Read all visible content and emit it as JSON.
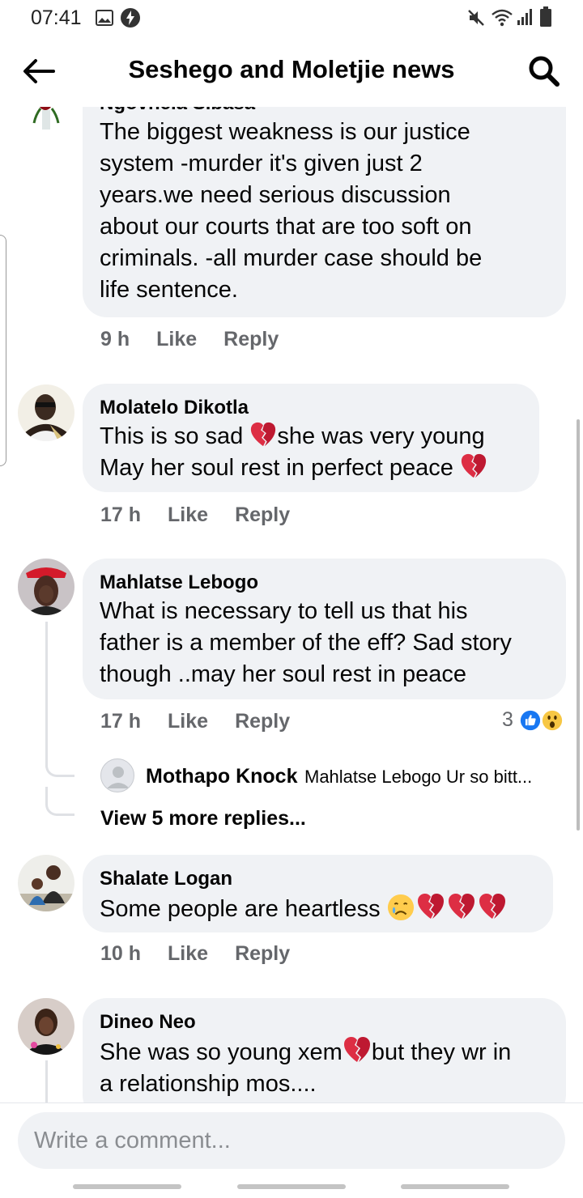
{
  "status_bar": {
    "time": "07:41",
    "icons": [
      "gallery-icon",
      "bolt-icon",
      "mute-icon",
      "wifi-icon",
      "signal-icon",
      "battery-icon"
    ]
  },
  "header": {
    "title": "Seshego and Moletjie news",
    "back_icon": "back-arrow-icon",
    "search_icon": "search-icon"
  },
  "comments": [
    {
      "author": "Ngovhela Sibasa",
      "text": "The biggest  weakness  is our justice\nsystem -murder it's given just 2\nyears.we need serious  discussion\nabout our courts that are too soft on\ncriminals. -all murder case should be\nlife sentence.",
      "time": "9 h",
      "like": "Like",
      "reply": "Reply"
    },
    {
      "author": "Molatelo Dikotla",
      "text_parts": [
        "This is so sad ",
        "she was very young",
        "May her soul rest in perfect peace "
      ],
      "time": "17 h",
      "like": "Like",
      "reply": "Reply"
    },
    {
      "author": "Mahlatse Lebogo",
      "text": "What is necessary to tell us that his\nfather is a member of the eff? Sad story\nthough ..may her soul rest in peace",
      "time": "17 h",
      "like": "Like",
      "reply": "Reply",
      "reaction_count": "3",
      "reaction_icons": [
        "like-reaction-icon",
        "wow-reaction-icon"
      ],
      "reply_preview": {
        "author": "Mothapo Knock",
        "text": "Mahlatse Lebogo Ur so bitt..."
      },
      "view_more": "View 5 more replies..."
    },
    {
      "author": "Shalate Logan",
      "text": "Some people are heartless ",
      "time": "10 h",
      "like": "Like",
      "reply": "Reply"
    },
    {
      "author": "Dineo Neo",
      "text_parts": [
        "She was so young xem",
        "but they wr in",
        "a relationship mos...."
      ]
    }
  ],
  "composer": {
    "placeholder": "Write a comment..."
  },
  "colors": {
    "bubble": "#f0f2f5",
    "meta_text": "#65676b",
    "like_blue": "#1877f2",
    "broken_heart": "#e8334a"
  }
}
